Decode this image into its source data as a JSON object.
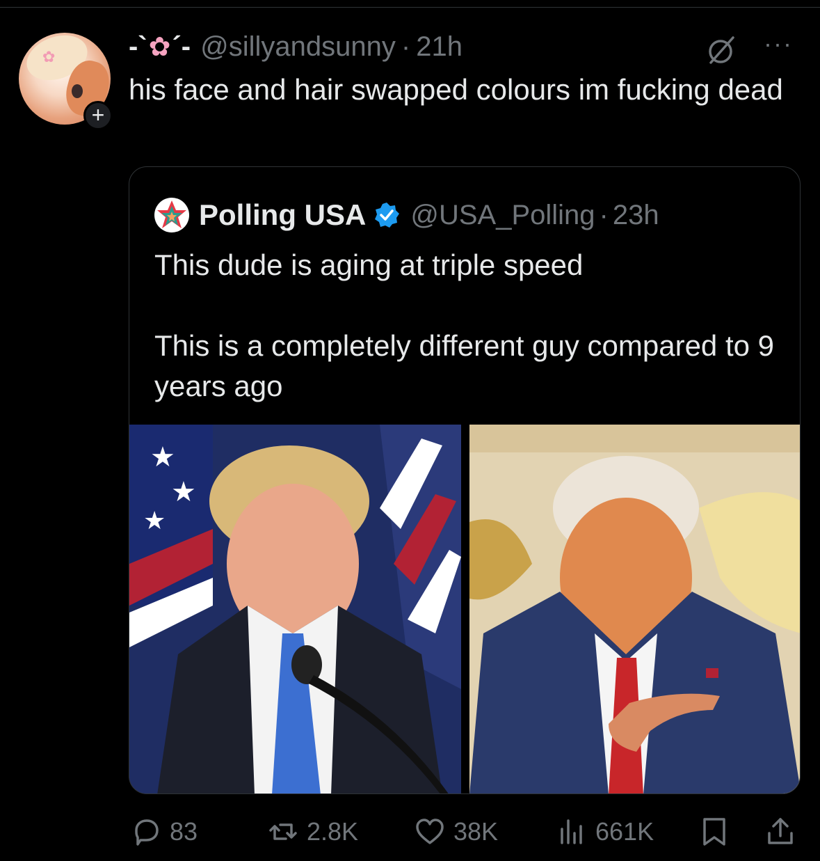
{
  "post": {
    "display_name_left": "-`",
    "display_name_right": "´-",
    "handle": "@sillyandsunny",
    "separator": "·",
    "time": "21h",
    "text": "his face and hair swapped colours im fucking dead",
    "follow_symbol": "+",
    "more_symbol": "···"
  },
  "quote": {
    "name": "Polling USA",
    "handle": "@USA_Polling",
    "separator": "·",
    "time": "23h",
    "text": "This dude is aging at triple speed\n\nThis is a completely different guy compared to 9 years ago"
  },
  "actions": {
    "replies": "83",
    "reposts": "2.8K",
    "likes": "38K",
    "views": "661K"
  },
  "icons": {
    "reply": "reply-icon",
    "repost": "repost-icon",
    "like": "heart-icon",
    "views": "views-icon",
    "bookmark": "bookmark-icon",
    "share": "share-icon",
    "grok": "grok-icon",
    "more": "more-icon"
  },
  "colors": {
    "background": "#000000",
    "text": "#e7e9ea",
    "muted": "#71767b",
    "border": "#2f3336",
    "verified": "#1d9bf0",
    "sakura": "#f5a3c0"
  }
}
